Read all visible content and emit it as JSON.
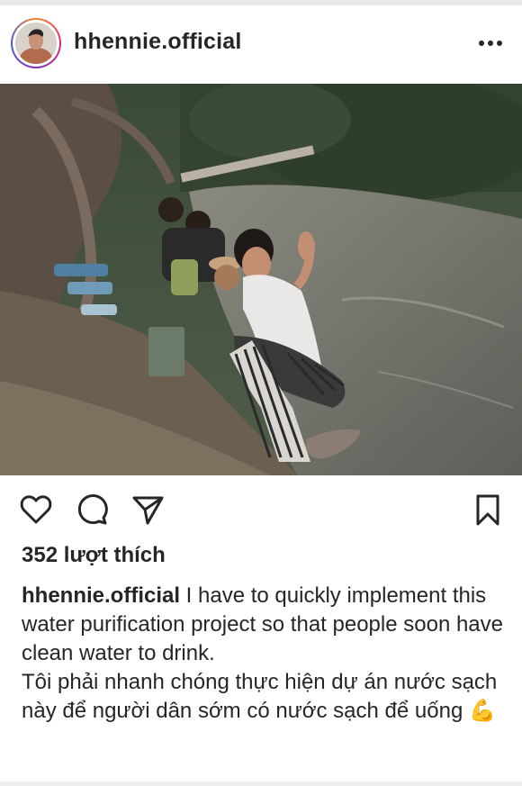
{
  "post": {
    "username": "hhennie.official",
    "more_icon": "more-horizontal-icon",
    "photo_alt": "",
    "likes_text": "352 lượt thích",
    "caption_username": "hhennie.official",
    "caption_en": " I have to quickly implement this water purification project so that people soon have clean water to drink.",
    "caption_vi": "Tôi phải nhanh chóng thực hiện dự án nước sạch này để người dân sớm có nước sạch để uống 💪"
  },
  "actions": {
    "like_icon": "heart-icon",
    "comment_icon": "comment-icon",
    "share_icon": "send-icon",
    "save_icon": "bookmark-icon"
  },
  "colors": {
    "text": "#262626",
    "story_ring_start": "#f58529",
    "story_ring_mid": "#dd2a7b",
    "story_ring_end": "#515bd4"
  }
}
